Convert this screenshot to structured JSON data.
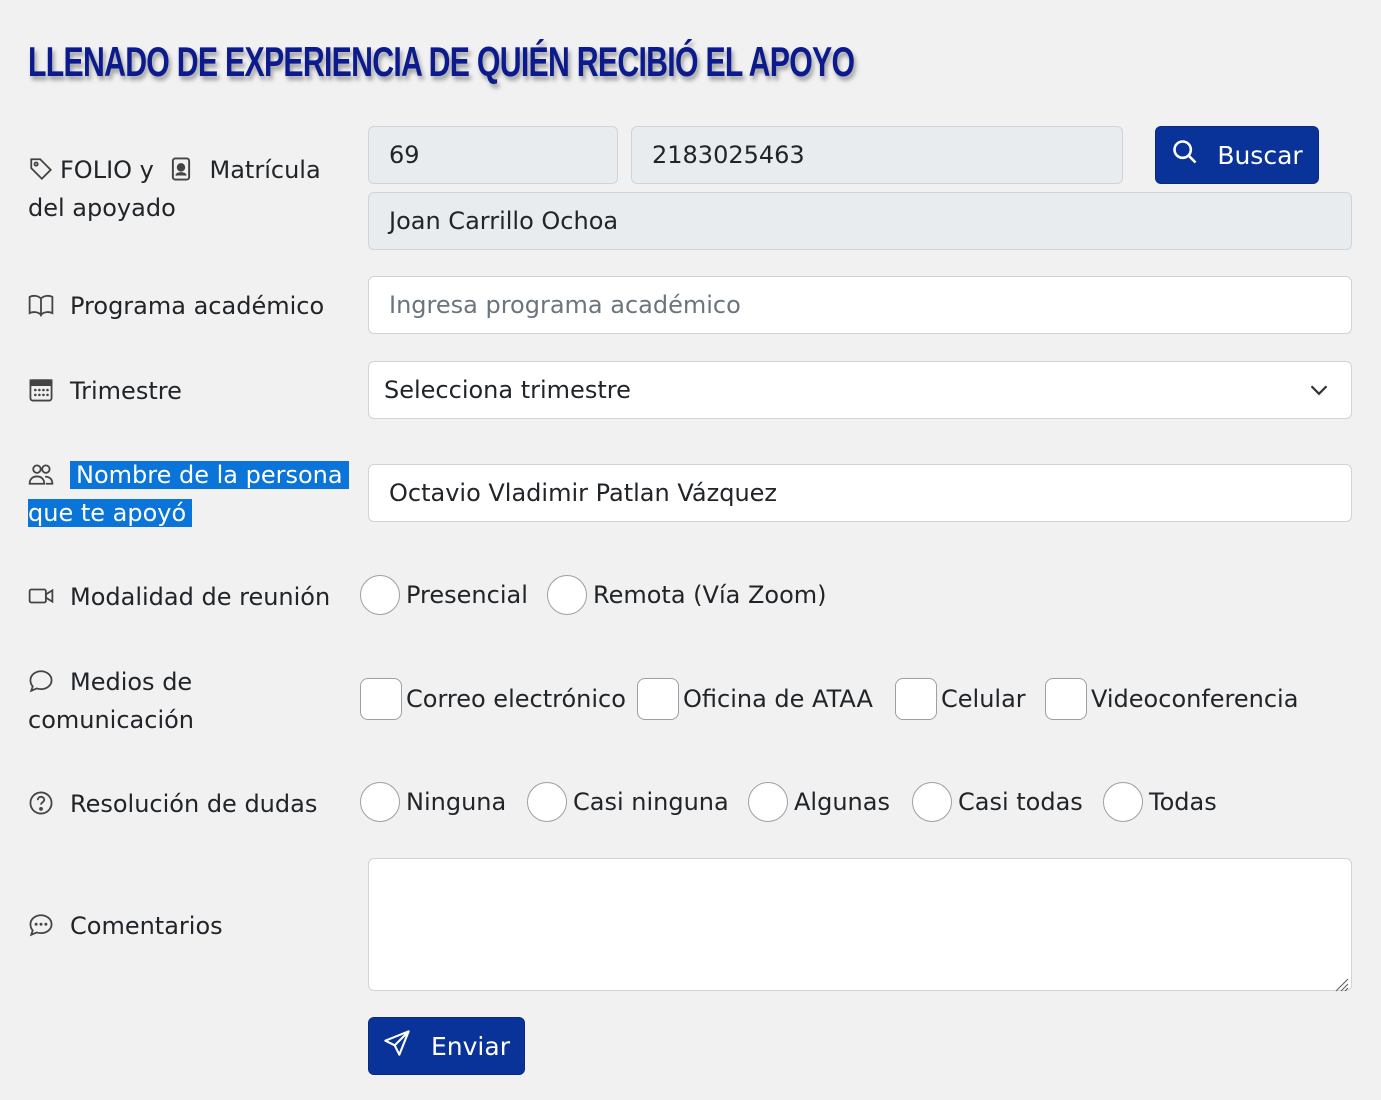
{
  "page": {
    "title": "LLENADO DE EXPERIENCIA DE QUIÉN RECIBIÓ EL APOYO"
  },
  "folio": {
    "label_part1": "FOLIO y",
    "label_part2": "Matrícula",
    "label_part3": "del apoyado",
    "folio_value": "69",
    "matricula_value": "2183025463",
    "search_button": "Buscar",
    "name_value": "Joan Carrillo Ochoa"
  },
  "programa": {
    "label": "Programa académico",
    "placeholder": "Ingresa programa académico"
  },
  "trimestre": {
    "label": "Trimestre",
    "selected": "Selecciona trimestre"
  },
  "persona": {
    "label_line1": "Nombre de la persona",
    "label_line2": "que te apoyó",
    "value": "Octavio Vladimir Patlan Vázquez"
  },
  "modalidad": {
    "label": "Modalidad de reunión",
    "options": [
      "Presencial",
      "Remota (Vía Zoom)"
    ]
  },
  "medios": {
    "label_line1": "Medios de",
    "label_line2": "comunicación",
    "options": [
      "Correo electrónico",
      "Oficina de ATAA",
      "Celular",
      "Videoconferencia"
    ]
  },
  "dudas": {
    "label": "Resolución de dudas",
    "options": [
      "Ninguna",
      "Casi ninguna",
      "Algunas",
      "Casi todas",
      "Todas"
    ]
  },
  "comentarios": {
    "label": "Comentarios",
    "value": ""
  },
  "submit": {
    "label": "Enviar"
  },
  "colors": {
    "primary": "#0a3399",
    "title": "#0b1a8c",
    "highlight": "#0a74d8",
    "background": "#f1f1f1"
  }
}
